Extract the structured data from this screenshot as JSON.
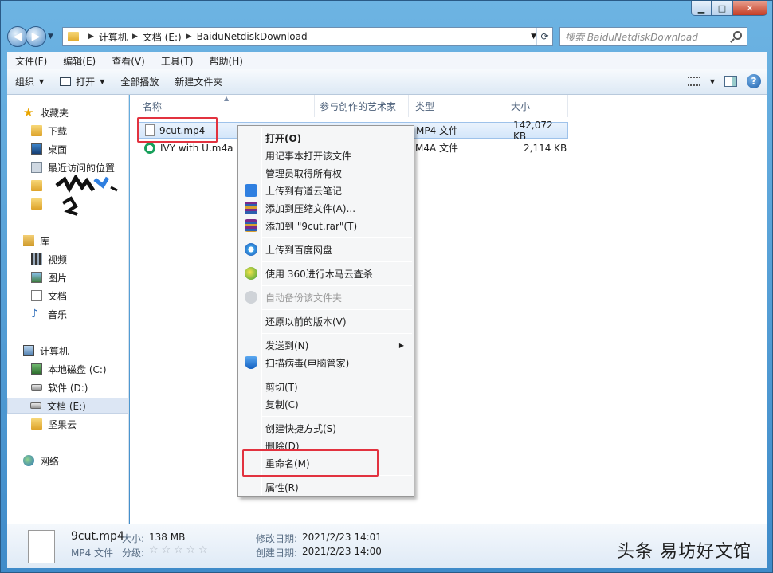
{
  "window": {
    "caption": {
      "minimize": "▁",
      "maximize": "□",
      "close": "✕"
    }
  },
  "address": {
    "back": "◀",
    "forward": "▶",
    "crumbs": [
      "计算机",
      "文档 (E:)",
      "BaiduNetdiskDownload"
    ],
    "search_placeholder": "搜索 BaiduNetdiskDownload"
  },
  "menubar": [
    "文件(F)",
    "编辑(E)",
    "查看(V)",
    "工具(T)",
    "帮助(H)"
  ],
  "toolbar": {
    "organize": "组织",
    "open": "打开",
    "play_all": "全部播放",
    "new_folder": "新建文件夹"
  },
  "nav": {
    "favorites": "收藏夹",
    "downloads": "下载",
    "desktop": "桌面",
    "recent": "最近访问的位置",
    "libraries": "库",
    "videos": "视频",
    "pictures": "图片",
    "documents": "文档",
    "music": "音乐",
    "computer": "计算机",
    "drive_c": "本地磁盘 (C:)",
    "drive_d": "软件 (D:)",
    "drive_e": "文档 (E:)",
    "jianguoyun": "坚果云",
    "network": "网络"
  },
  "columns": [
    "名称",
    "参与创作的艺术家",
    "类型",
    "大小"
  ],
  "files": [
    {
      "name": "9cut.mp4",
      "type": "MP4 文件",
      "size": "142,072 KB"
    },
    {
      "name": "IVY with U.m4a",
      "type": "M4A 文件",
      "size": "2,114 KB"
    }
  ],
  "context_menu": [
    "打开(O)",
    "用记事本打开该文件",
    "管理员取得所有权",
    "上传到有道云笔记",
    "添加到压缩文件(A)...",
    "添加到 \"9cut.rar\"(T)",
    "上传到百度网盘",
    "使用 360进行木马云查杀",
    "自动备份该文件夹",
    "还原以前的版本(V)",
    "发送到(N)",
    "扫描病毒(电脑管家)",
    "剪切(T)",
    "复制(C)",
    "创建快捷方式(S)",
    "删除(D)",
    "重命名(M)",
    "属性(R)"
  ],
  "status": {
    "filename": "9cut.mp4",
    "size_label": "大小:",
    "size": "138 MB",
    "type": "MP4 文件",
    "rating_label": "分级:",
    "rating": 0,
    "modified_label": "修改日期:",
    "modified": "2021/2/23 14:01",
    "created_label": "创建日期:",
    "created": "2021/2/23 14:00"
  },
  "watermark": "头条 易坊好文馆",
  "highlight_color": "#e2323f"
}
